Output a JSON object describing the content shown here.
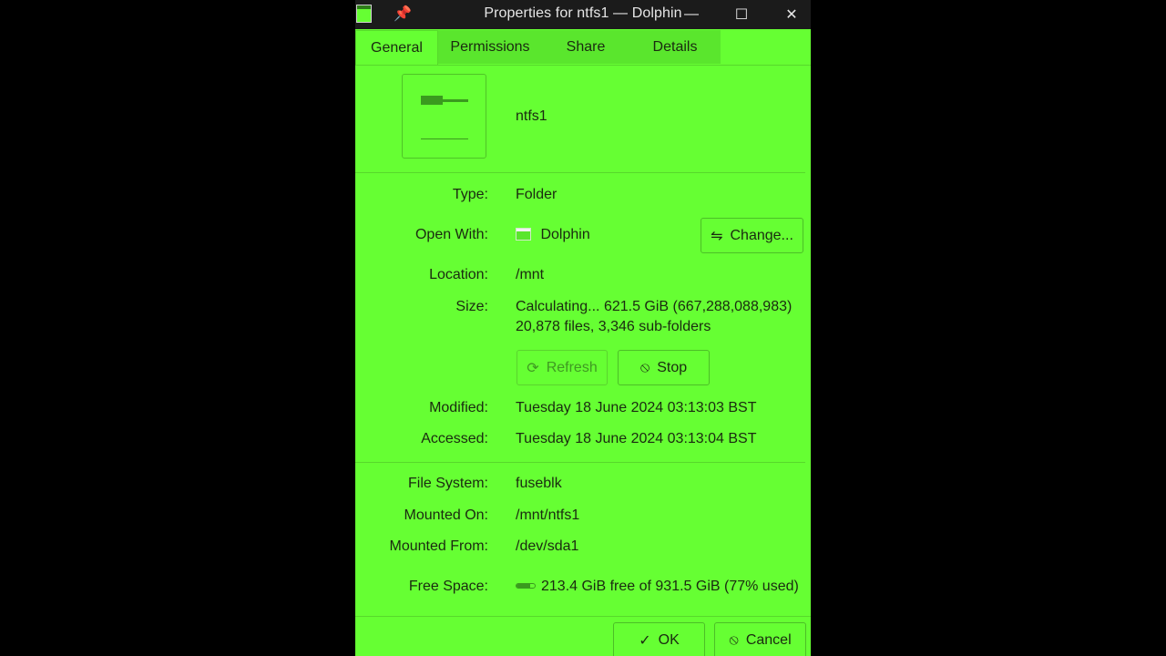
{
  "window": {
    "title": "Properties for ntfs1 — Dolphin",
    "minimize_glyph": "—",
    "maximize_glyph": "☐",
    "close_glyph": "✕"
  },
  "tabs": [
    {
      "label": "General"
    },
    {
      "label": "Permissions"
    },
    {
      "label": "Share"
    },
    {
      "label": "Details"
    }
  ],
  "file": {
    "name": "ntfs1"
  },
  "props": {
    "type_label": "Type:",
    "type_value": "Folder",
    "open_with_label": "Open With:",
    "open_with_value": "Dolphin",
    "change_button": "Change...",
    "location_label": "Location:",
    "location_value": "/mnt",
    "size_label": "Size:",
    "size_line1": "Calculating... 621.5 GiB (667,288,088,983)",
    "size_line2": "20,878 files, 3,346 sub-folders",
    "refresh_button": "Refresh",
    "stop_button": "Stop",
    "modified_label": "Modified:",
    "modified_value": "Tuesday 18 June 2024 03:13:03 BST",
    "accessed_label": "Accessed:",
    "accessed_value": "Tuesday 18 June 2024 03:13:04 BST",
    "filesystem_label": "File System:",
    "filesystem_value": "fuseblk",
    "mounted_on_label": "Mounted On:",
    "mounted_on_value": "/mnt/ntfs1",
    "mounted_from_label": "Mounted From:",
    "mounted_from_value": "/dev/sda1",
    "free_space_label": "Free Space:",
    "free_space_value": "213.4 GiB free of 931.5 GiB (77% used)",
    "used_fraction": 0.77
  },
  "footer": {
    "ok_button": "OK",
    "cancel_button": "Cancel"
  },
  "colors": {
    "background": "#66ff33",
    "titlebar": "#1b1b1b"
  }
}
